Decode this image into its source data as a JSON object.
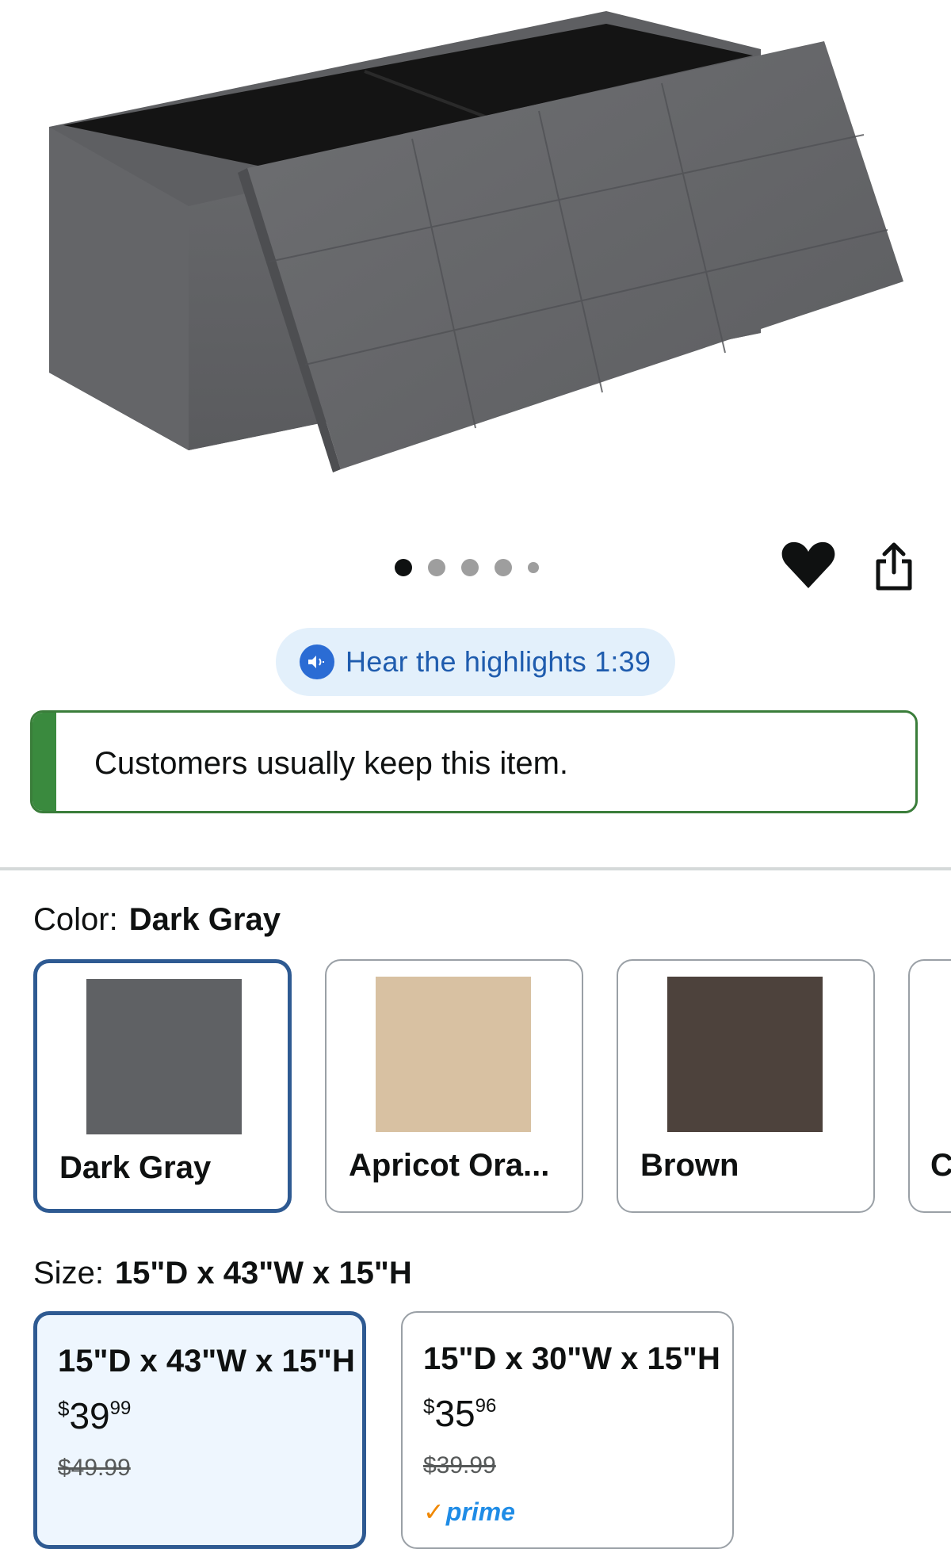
{
  "hear_button": {
    "label": "Hear the highlights 1:39"
  },
  "keep_banner": {
    "text": "Customers usually keep this item."
  },
  "color": {
    "label": "Color:",
    "selected": "Dark Gray",
    "options": [
      {
        "name": "Dark Gray",
        "swatch": "#5f6164"
      },
      {
        "name": "Apricot Ora...",
        "swatch": "#d8c1a2"
      },
      {
        "name": "Brown",
        "swatch": "#4d423c"
      },
      {
        "name": "C",
        "swatch": "#cccccc"
      }
    ]
  },
  "size": {
    "label": "Size:",
    "selected": "15\"D x 43\"W x 15\"H",
    "options": [
      {
        "title": "15\"D x 43\"W x 15\"H",
        "currency": "$",
        "price_whole": "39",
        "price_fraction": "99",
        "list_price": "$49.99"
      },
      {
        "title": "15\"D x 30\"W x 15\"H",
        "currency": "$",
        "price_whole": "35",
        "price_fraction": "96",
        "list_price": "$39.99",
        "badge": "prime"
      }
    ]
  },
  "icons": [
    "heart-icon",
    "share-icon",
    "audio-icon"
  ],
  "colors": {
    "accent_blue": "#2e5a92",
    "keep_green": "#3a8a3e",
    "hear_bg": "#e3f0fb"
  }
}
